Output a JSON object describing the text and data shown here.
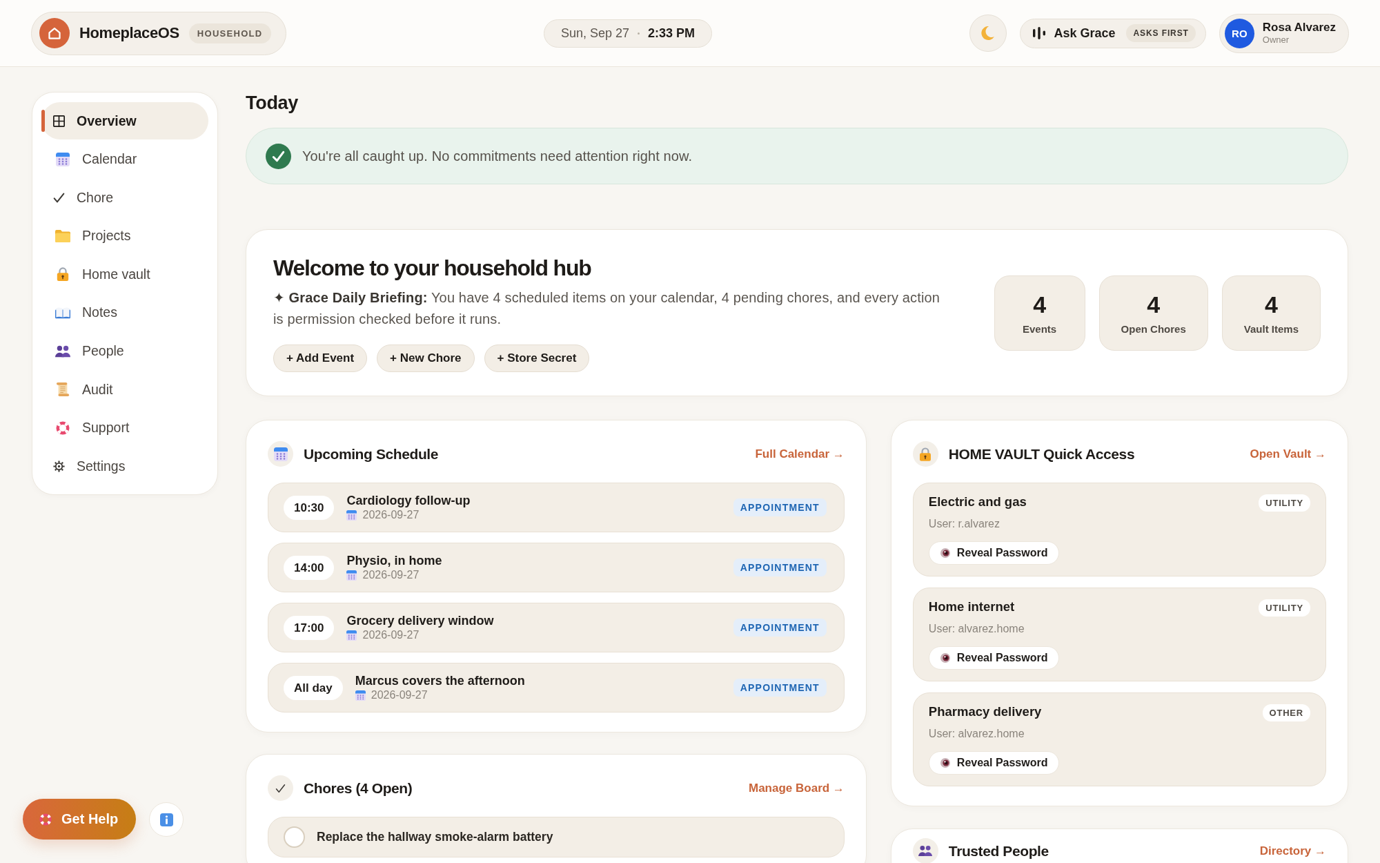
{
  "header": {
    "brand": {
      "name": "HomeplaceOS",
      "badge": "HOUSEHOLD"
    },
    "clock": {
      "date": "Sun, Sep 27",
      "time": "2:33 PM"
    },
    "assistant": {
      "label": "Ask Grace",
      "badge": "ASKS FIRST"
    },
    "user": {
      "initials": "RO",
      "name": "Rosa Alvarez",
      "role": "Owner"
    }
  },
  "sidebar": {
    "items": [
      {
        "label": "Overview",
        "selected": true
      },
      {
        "label": "Calendar",
        "selected": false
      },
      {
        "label": "Chore",
        "selected": false
      },
      {
        "label": "Projects",
        "selected": false
      },
      {
        "label": "Home vault",
        "selected": false
      },
      {
        "label": "Notes",
        "selected": false
      },
      {
        "label": "People",
        "selected": false
      },
      {
        "label": "Audit",
        "selected": false
      },
      {
        "label": "Support",
        "selected": false
      },
      {
        "label": "Settings",
        "selected": false
      }
    ]
  },
  "page_title": "Today",
  "banner": {
    "text": "You're all caught up. No commitments need attention right now."
  },
  "welcome": {
    "title": "Welcome to your household hub",
    "briefing": "**✦ Grace Daily Briefing:** You have 4 scheduled items on your calendar, 4 pending chores, and every action is permission checked before it runs.",
    "actions": [
      "+ Add Event",
      "+ New Chore",
      "+ Store Secret"
    ],
    "stats": [
      {
        "value": "4",
        "label": "Events"
      },
      {
        "value": "4",
        "label": "Open Chores"
      },
      {
        "value": "4",
        "label": "Vault Items"
      }
    ]
  },
  "schedule": {
    "title": "Upcoming Schedule",
    "link": "Full Calendar →",
    "events": [
      {
        "time": "10:30",
        "title": "Cardiology follow-up",
        "date": "2026-09-27",
        "tag": "APPOINTMENT"
      },
      {
        "time": "14:00",
        "title": "Physio, in home",
        "date": "2026-09-27",
        "tag": "APPOINTMENT"
      },
      {
        "time": "17:00",
        "title": "Grocery delivery window",
        "date": "2026-09-27",
        "tag": "APPOINTMENT"
      },
      {
        "time": "All day",
        "title": "Marcus covers the afternoon",
        "date": "2026-09-27",
        "tag": "APPOINTMENT"
      }
    ]
  },
  "vault": {
    "title": "HOME VAULT Quick Access",
    "link": "Open Vault →",
    "items": [
      {
        "name": "Electric and gas",
        "user": "User: r.alvarez",
        "type": "UTILITY",
        "action": "Reveal Password"
      },
      {
        "name": "Home internet",
        "user": "User: alvarez.home",
        "type": "UTILITY",
        "action": "Reveal Password"
      },
      {
        "name": "Pharmacy delivery",
        "user": "User: alvarez.home",
        "type": "OTHER",
        "action": "Reveal Password"
      }
    ]
  },
  "chores": {
    "title": "Chores (4 Open)",
    "link": "Manage Board →",
    "items": [
      {
        "label": "Replace the hallway smoke-alarm battery",
        "checked": false
      }
    ]
  },
  "trusted_people": {
    "title": "Trusted People",
    "link": "Directory →"
  },
  "help": {
    "label": "Get Help"
  }
}
